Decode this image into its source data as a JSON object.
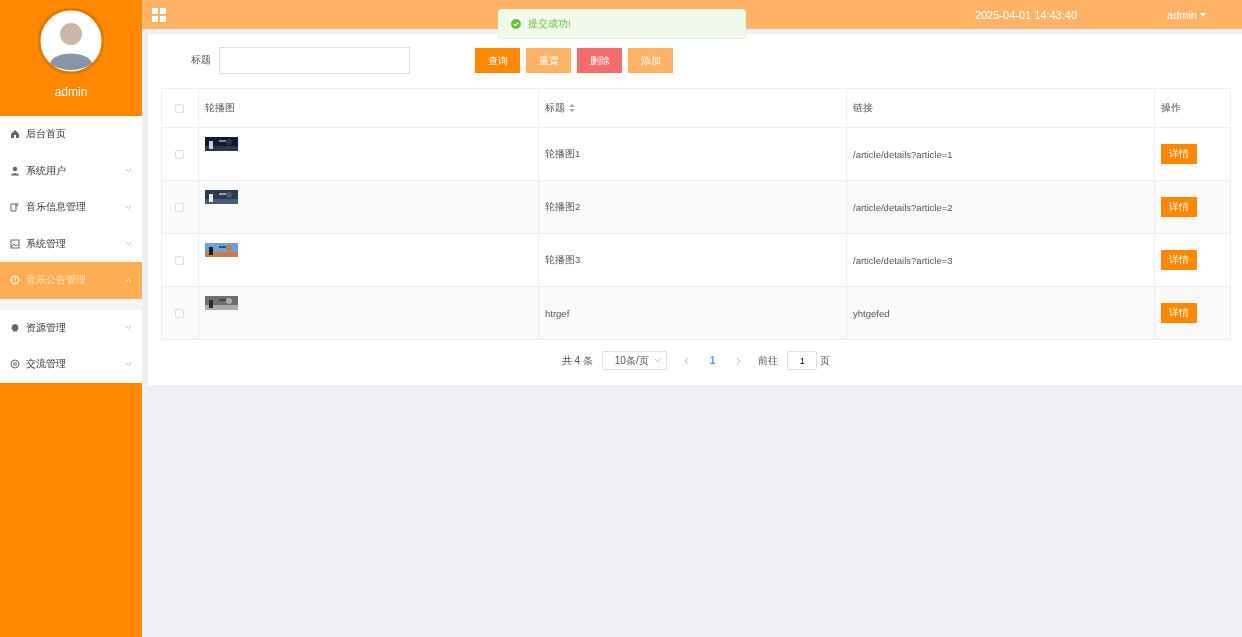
{
  "sidebar": {
    "user": "admin",
    "menu": [
      {
        "label": "后台首页",
        "selected": false,
        "expandable": false
      },
      {
        "label": "系统用户",
        "selected": false,
        "expandable": true
      },
      {
        "label": "音乐信息管理",
        "selected": false,
        "expandable": true
      },
      {
        "label": "系统管理",
        "selected": false,
        "expandable": true
      },
      {
        "label": "音乐公告管理",
        "selected": true,
        "expandable": true
      },
      {
        "label": "资源管理",
        "selected": false,
        "expandable": true
      },
      {
        "label": "交流管理",
        "selected": false,
        "expandable": true
      }
    ]
  },
  "header": {
    "datetime": "2025-04-01 14:43:40",
    "user": "admin"
  },
  "toast": {
    "message": "提交成功!"
  },
  "search": {
    "label": "标题",
    "buttons": [
      {
        "label": "查询",
        "kind": "primary"
      },
      {
        "label": "重置",
        "kind": "light"
      },
      {
        "label": "删除",
        "kind": "danger"
      },
      {
        "label": "添加",
        "kind": "light"
      }
    ]
  },
  "table": {
    "columns": [
      "轮播图",
      "标题",
      "链接",
      "操作"
    ],
    "header_checked": false,
    "rows": [
      {
        "checked": false,
        "title": "轮播图1",
        "link": "/article/details?article=1",
        "action": "详情"
      },
      {
        "checked": false,
        "title": "轮播图2",
        "link": "/article/details?article=2",
        "action": "详情"
      },
      {
        "checked": false,
        "title": "轮播图3",
        "link": "/article/details?article=3",
        "action": "详情"
      },
      {
        "checked": false,
        "title": "htrgef",
        "link": "yhtgefed",
        "action": "详情"
      }
    ]
  },
  "pagination": {
    "total": "共 4 条",
    "page_size": "10条/页",
    "pages": [
      {
        "label": "1",
        "selected": true
      }
    ],
    "goto_label": "前往",
    "goto_value": "1",
    "page_unit": "页"
  }
}
